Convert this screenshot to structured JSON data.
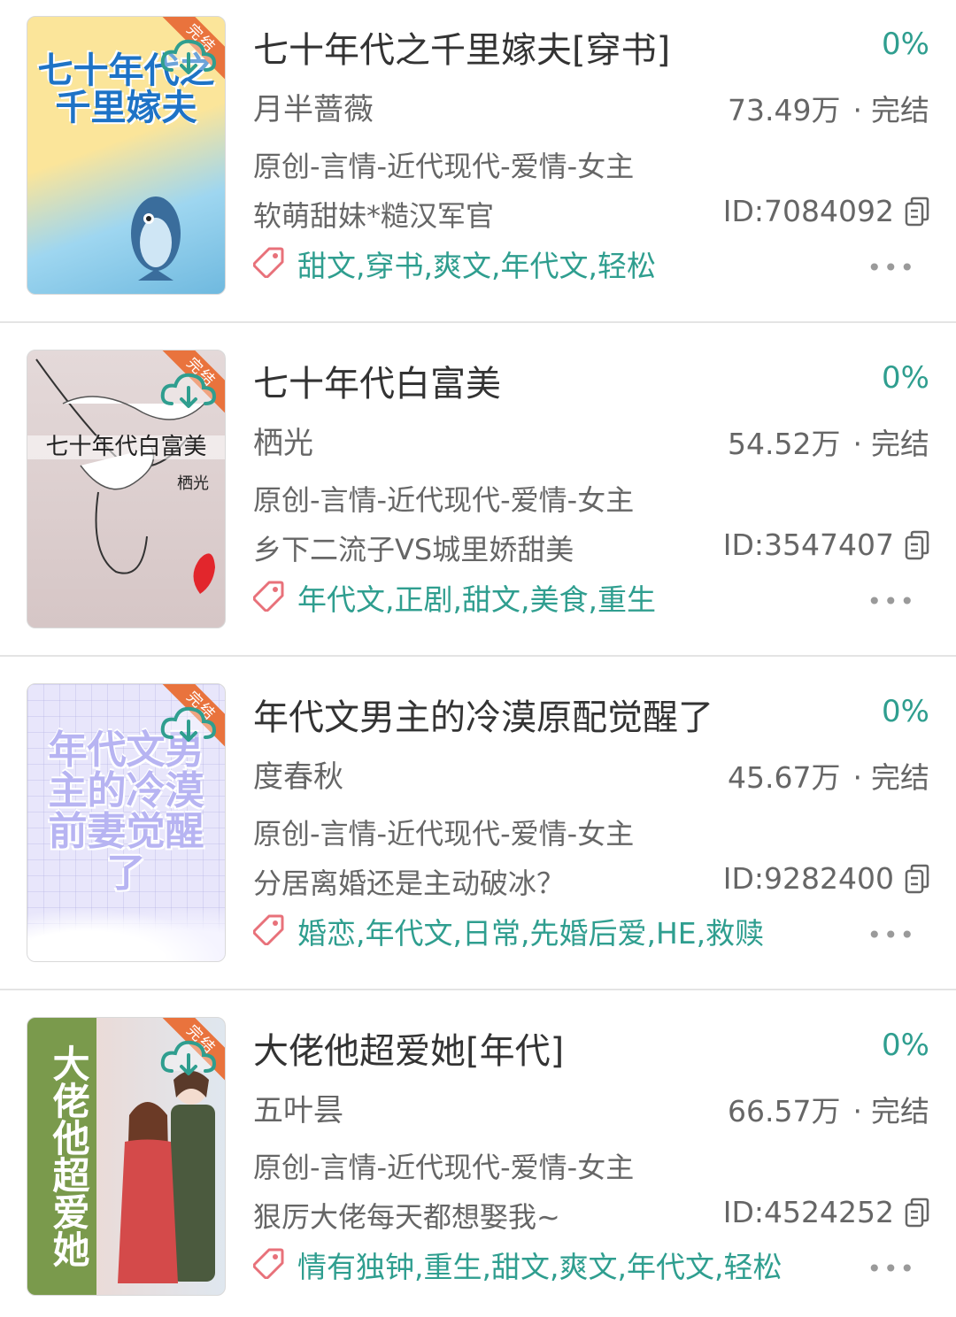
{
  "books": [
    {
      "title": "七十年代之千里嫁夫[穿书]",
      "progress": "0%",
      "author": "月半蔷薇",
      "word_count": "73.49万",
      "status": "完结",
      "genre": "原创-言情-近代现代-爱情-女主",
      "summary": "软萌甜妹*糙汉军官",
      "id": "ID:7084092",
      "tags": "甜文,穿书,爽文,年代文,轻松",
      "more": "•••",
      "ribbon": "完结",
      "cover_text": "七十年代之千里嫁夫",
      "cover_colors": [
        "#fbe59a",
        "#8fd0ec"
      ]
    },
    {
      "title": "七十年代白富美",
      "progress": "0%",
      "author": "栖光",
      "word_count": "54.52万",
      "status": "完结",
      "genre": "原创-言情-近代现代-爱情-女主",
      "summary": "乡下二流子VS城里娇甜美",
      "id": "ID:3547407",
      "tags": "年代文,正剧,甜文,美食,重生",
      "more": "•••",
      "ribbon": "完结",
      "cover_text": "七十年代白富美",
      "cover_author": "栖光",
      "cover_colors": [
        "#dccfcf",
        "#d8c7c7"
      ]
    },
    {
      "title": "年代文男主的冷漠原配觉醒了",
      "progress": "0%",
      "author": "度春秋",
      "word_count": "45.67万",
      "status": "完结",
      "genre": "原创-言情-近代现代-爱情-女主",
      "summary": "分居离婚还是主动破冰？",
      "id": "ID:9282400",
      "tags": "婚恋,年代文,日常,先婚后爱,HE,救赎",
      "more": "•••",
      "ribbon": "完结",
      "cover_text": "年代文男主的冷漠前妻觉醒了",
      "cover_colors": [
        "#e6e4fb",
        "#c9c8f3"
      ]
    },
    {
      "title": "大佬他超爱她[年代]",
      "progress": "0%",
      "author": "五叶昙",
      "word_count": "66.57万",
      "status": "完结",
      "genre": "原创-言情-近代现代-爱情-女主",
      "summary": "狠厉大佬每天都想娶我~",
      "id": "ID:4524252",
      "tags": "情有独钟,重生,甜文,爽文,年代文,轻松",
      "more": "•••",
      "ribbon": "完结",
      "cover_text": "大佬他超爱她",
      "cover_colors": [
        "#7a9a4c",
        "#e8d6d2"
      ]
    }
  ],
  "colors": {
    "accent": "#2f9e8f",
    "text_primary": "#333333",
    "text_secondary": "#666666",
    "ribbon": "#e9733d",
    "tag_icon": "#e8717a"
  },
  "icons": {
    "download": "cloud-download-icon",
    "copy": "copy-icon",
    "tag": "tag-icon",
    "more": "more-dots-icon"
  }
}
